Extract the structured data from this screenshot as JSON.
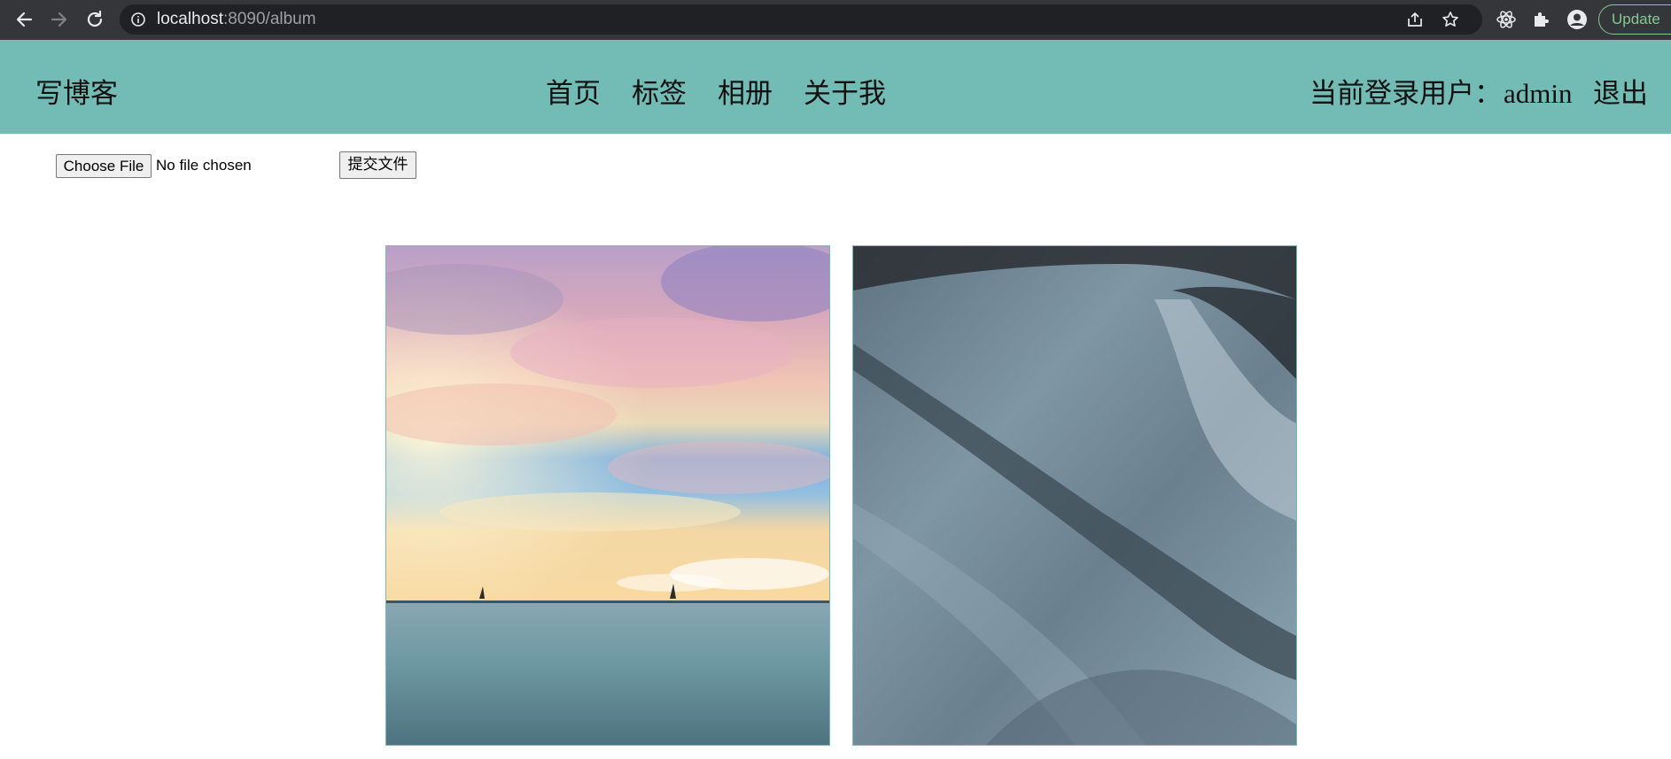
{
  "browser": {
    "url_host": "localhost",
    "url_path": ":8090/album",
    "update_label": "Update"
  },
  "header": {
    "logo": "写博客",
    "nav": [
      {
        "label": "首页"
      },
      {
        "label": "标签"
      },
      {
        "label": "相册"
      },
      {
        "label": "关于我"
      }
    ],
    "user_prefix": "当前登录用户：",
    "username": "admin",
    "logout": "退出"
  },
  "upload": {
    "choose_label": "Choose File",
    "status": "No file chosen",
    "submit_label": "提交文件"
  },
  "album": {
    "photos": [
      {
        "name": "sunset-sea-photo"
      },
      {
        "name": "grey-fabric-photo"
      }
    ]
  },
  "colors": {
    "header_bg": "#73bbb5",
    "chrome_bg": "#35363a",
    "omnibox_bg": "#202124",
    "update_accent": "#81c995"
  }
}
